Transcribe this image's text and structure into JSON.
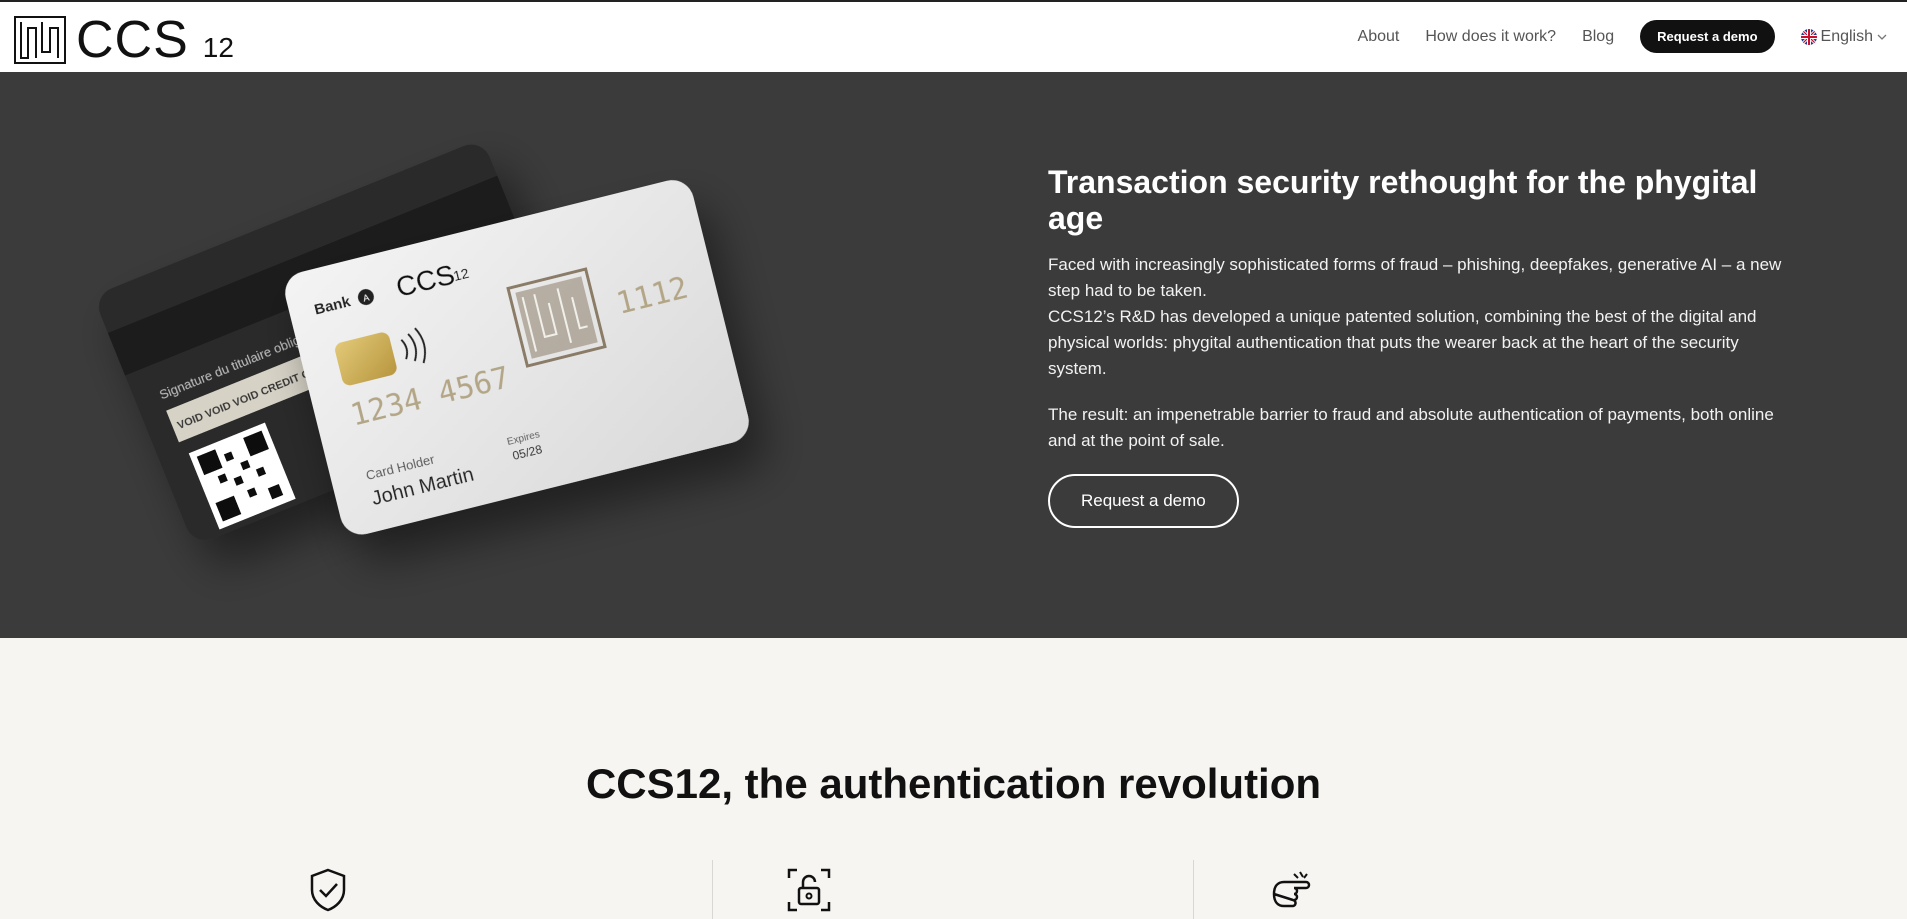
{
  "header": {
    "logo_text": "CCS",
    "logo_sub": "12",
    "nav": [
      {
        "label": "About"
      },
      {
        "label": "How does it work?"
      },
      {
        "label": "Blog"
      }
    ],
    "cta": "Request a demo",
    "language": "English",
    "language_icon": "uk-flag-icon"
  },
  "hero": {
    "title": "Transaction security rethought for the phygital age",
    "p1": "Faced with increasingly sophisticated forms of fraud – phishing, deepfakes, generative AI – a new step had to be taken.",
    "p2": "CCS12’s R&D has developed a unique patented solution, combining the best of the digital and physical worlds: phygital authentication that puts the wearer back at the heart of the security system.",
    "p3": "The result: an impenetrable barrier to fraud and absolute authentication of payments, both online and at the point of sale.",
    "cta": "Request a demo",
    "card": {
      "bank": "Bank",
      "bank_badge": "A",
      "brand": "CCS",
      "brand_sub": "12",
      "number_left": "1234 4567",
      "number_right": "1112",
      "holder_label": "Card Holder",
      "holder_name": "John Martin",
      "expires_label": "Expires",
      "expires_value": "05/28",
      "back_signature": "Signature du titulaire obligatoire",
      "back_void": "VOID VOID VOID CREDIT CARD SECURE"
    }
  },
  "section": {
    "title": "CCS12, the authentication revolution",
    "features": [
      {
        "icon": "shield-check-icon"
      },
      {
        "icon": "lock-scan-icon"
      },
      {
        "icon": "hand-pointing-icon"
      }
    ]
  }
}
